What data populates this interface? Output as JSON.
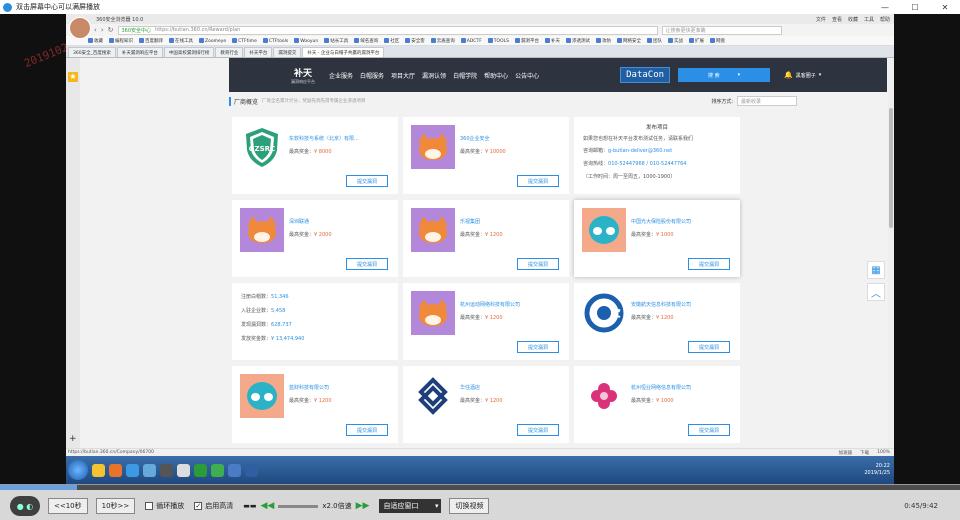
{
  "player": {
    "title": "双击屏幕中心可以满屏播放",
    "watermark": "20191023150",
    "controls": {
      "back_label": "<<10秒",
      "forward_label": "10秒>>",
      "loop_label": "循环播放",
      "hd_label": "启用高清",
      "speed_label": "x2.0倍速",
      "window_label": "自适应窗口",
      "switch_label": "切换视频",
      "time": "0:45/9:42",
      "progress": 0.08
    }
  },
  "browser": {
    "title": "360安全浏览器 10.0",
    "menus": [
      "文件",
      "查看",
      "收藏",
      "工具",
      "帮助"
    ],
    "url_prefix": "360安全中心",
    "url": "https://butian.360.cn/Reward/plan",
    "search_placeholder": "让搜索更快更准确",
    "bookmarks": [
      "收藏",
      "编程知识",
      "百度翻译",
      "在线工具",
      "Zoomeye",
      "CTFtime",
      "CTFtools",
      "Wooyun",
      "站长工具",
      "域名查询",
      "社区",
      "安全客",
      "云盾查询",
      "ADCTF",
      "TOOLS",
      "漏洞平台",
      "补天",
      "渗透测试",
      "攻防",
      "网络安全",
      "团队",
      "实战",
      "扩展",
      "网盘"
    ],
    "tabs": [
      "360安全_百度搜索",
      "补天漏洞响应平台",
      "中国高校漏洞排行榜",
      "教育行业",
      "补天平台",
      "漏洞提交",
      "补天 - 企业与白帽子共赢的漏洞平台"
    ],
    "status_url": "https://butian.360.cn/Company/06700",
    "status_right": [
      "加速器",
      "下载",
      "100%"
    ]
  },
  "site": {
    "logo_name": "补天",
    "logo_sub": "漏洞响应平台",
    "nav": [
      "企业服务",
      "白帽服务",
      "项目大厅",
      "漏洞认领",
      "白帽学院",
      "帮助中心",
      "公告中心"
    ],
    "datacon": "DataCon",
    "search_label": "搜 索",
    "user": "黑客圈子",
    "list_title": "厂商概览",
    "list_sub": "厂商全名累计计分，奖励先到先得专属企业渗透项目",
    "sort_label": "排序方式:",
    "sort_value": "最新收录"
  },
  "cards": [
    {
      "name": "东软科技与系统（北京）有限...",
      "prize_label": "最高奖金：",
      "prize": "¥ 8000",
      "logo": "gzsrc-shield-icon",
      "button": "提交漏洞"
    },
    {
      "name": "360企业安全",
      "prize_label": "最高奖金：",
      "prize": "¥ 10000",
      "logo": "fox-mascot-icon",
      "button": "提交漏洞"
    },
    {
      "name": "深圳联通",
      "prize_label": "最高奖金：",
      "prize": "¥ 2000",
      "logo": "fox-mascot-icon",
      "button": "提交漏洞"
    },
    {
      "name": "乐视集团",
      "prize_label": "最高奖金：",
      "prize": "¥ 1200",
      "logo": "fox-mascot-icon",
      "button": "提交漏洞"
    },
    {
      "name": "中国光大保险股份有限公司",
      "prize_label": "最高奖金：",
      "prize": "¥ 1000",
      "logo": "bird-mascot-icon",
      "button": "提交漏洞"
    },
    {
      "name": "杭州运动网络科技有限公司",
      "prize_label": "最高奖金：",
      "prize": "¥ 1200",
      "logo": "fox-mascot-icon",
      "button": "提交漏洞"
    },
    {
      "name": "安徽航天信息科技有限公司",
      "prize_label": "最高奖金：",
      "prize": "¥ 1200",
      "logo": "globe-icon",
      "button": "提交漏洞"
    },
    {
      "name": "蓝财科技有限公司",
      "prize_label": "最高奖金：",
      "prize": "¥ 1200",
      "logo": "bird-mascot-icon",
      "button": "提交漏洞"
    },
    {
      "name": "华住酒店",
      "prize_label": "最高奖金：",
      "prize": "¥ 1200",
      "logo": "knot-icon",
      "button": "提交漏洞"
    },
    {
      "name": "杭州恒业网络信息有限公司",
      "prize_label": "最高奖金：",
      "prize": "¥ 1000",
      "logo": "flower-icon",
      "button": "提交漏洞"
    }
  ],
  "publish": {
    "heading": "发布项目",
    "desc": "如果您也想在补天平台发布测试任务，请联系我们",
    "email_label": "咨询邮箱：",
    "email": "g-butian-deliver@360.net",
    "phone_label": "咨询热线：",
    "phone": "010-52447968 / 010-52447764",
    "hours": "（工作时间：周一至周五，1000-1900）"
  },
  "stats": [
    {
      "label": "注册白帽数：",
      "value": "51,346"
    },
    {
      "label": "入驻企业数：",
      "value": "5,458"
    },
    {
      "label": "发现漏洞数：",
      "value": "628,737"
    },
    {
      "label": "发放奖金数：",
      "value": "¥ 13,474,940"
    }
  ],
  "taskbar": {
    "time": "20:22",
    "date": "2019/1/25"
  }
}
